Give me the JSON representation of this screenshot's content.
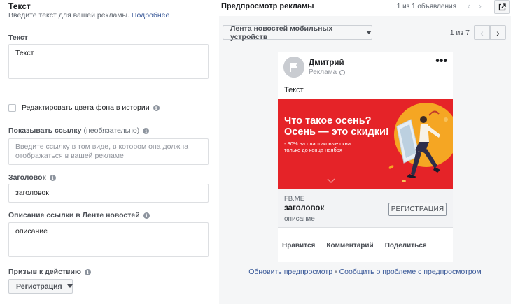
{
  "form": {
    "section_title": "Текст",
    "section_subtitle": "Введите текст для вашей рекламы.",
    "section_link": "Подробнее",
    "text_label": "Текст",
    "text_value": "Текст",
    "edit_bg_label": "Редактировать цвета фона в истории",
    "show_link_label": "Показывать ссылку",
    "show_link_optional": "(необязательно)",
    "show_link_placeholder_line1": "Введите ссылку в том виде, в котором она должна",
    "show_link_placeholder_line2": "отображаться в вашей рекламе",
    "headline_label": "Заголовок",
    "headline_value": "заголовок",
    "description_label": "Описание ссылки в Ленте новостей",
    "description_value": "описание",
    "cta_label": "Призыв к действию",
    "cta_value": "Регистрация"
  },
  "preview": {
    "title": "Предпросмотр рекламы",
    "ad_count": "1 из 1 объявления",
    "placement": "Лента новостей мобильных устройств",
    "position": "1 из 7",
    "page_name": "Дмитрий",
    "sponsored": "Реклама",
    "post_text": "Текст",
    "banner_line1": "Что такое осень?",
    "banner_line2": "Осень — это скидки!",
    "banner_small1": "- 30% на пластиковые окна",
    "banner_small2": "только до конца ноября",
    "link_domain": "FB.ME",
    "link_headline": "заголовок",
    "link_description": "описание",
    "link_cta": "РЕГИСТРАЦИЯ",
    "actions": [
      "Нравится",
      "Комментарий",
      "Поделиться"
    ],
    "footer_refresh": "Обновить предпросмотр",
    "footer_sep": "•",
    "footer_report": "Сообщить о проблеме с предпросмотром"
  },
  "colors": {
    "banner_red": "#e52328",
    "link_blue": "#385898",
    "accent_orange": "#f5a623"
  },
  "icons": [
    "info-icon",
    "caret-down-icon",
    "external-link-icon",
    "chevron-left-icon",
    "chevron-right-icon",
    "globe-icon",
    "more-icon"
  ]
}
